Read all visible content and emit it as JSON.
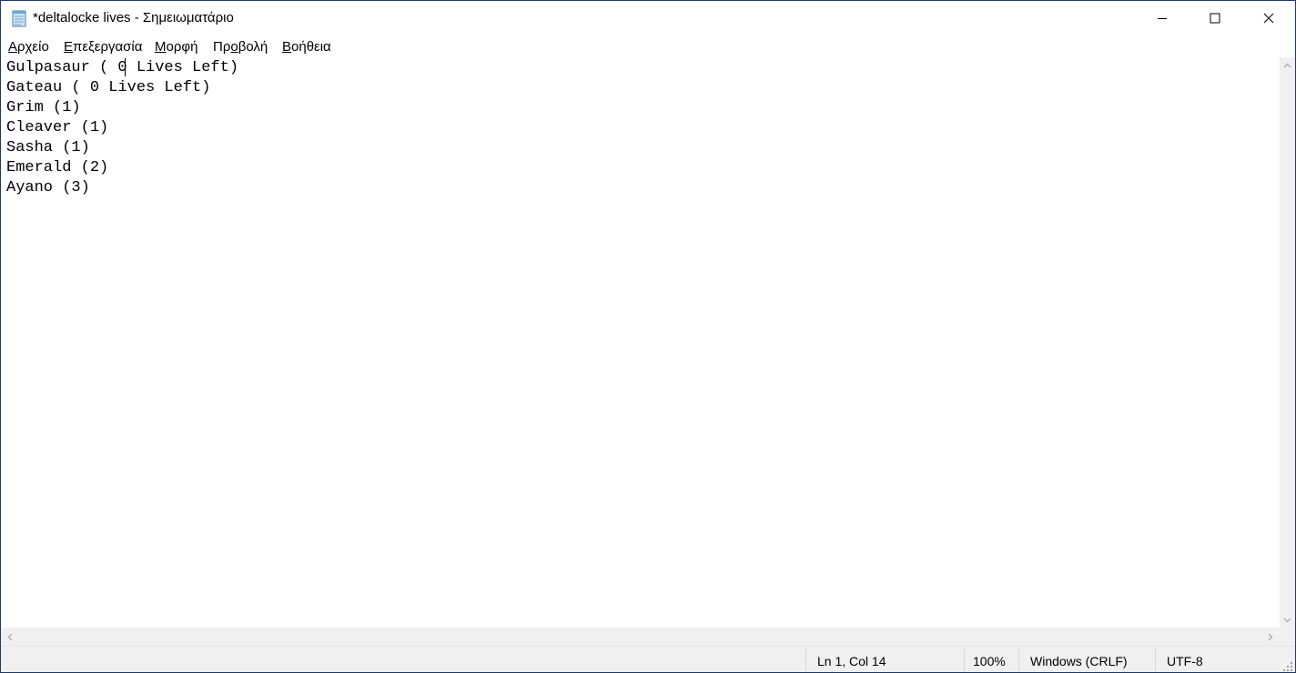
{
  "window": {
    "title": "*deltalocke lives - Σημειωματάριο"
  },
  "menu": {
    "items": [
      {
        "pre": "",
        "acc": "Α",
        "post": "ρχείο"
      },
      {
        "pre": "",
        "acc": "Ε",
        "post": "πεξεργασία"
      },
      {
        "pre": "",
        "acc": "Μ",
        "post": "ορφή"
      },
      {
        "pre": "Πρ",
        "acc": "ο",
        "post": "βολή"
      },
      {
        "pre": "",
        "acc": "Β",
        "post": "οήθεια"
      }
    ]
  },
  "editor": {
    "lines": [
      "Gulpasaur ( 0 Lives Left)",
      "Gateau ( 0 Lives Left)",
      "Grim (1)",
      "Cleaver (1)",
      "Sasha (1)",
      "Emerald (2)",
      "Ayano (3)"
    ]
  },
  "status": {
    "position": "Ln 1, Col 14",
    "zoom": "100%",
    "line_ending": "Windows (CRLF)",
    "encoding": "UTF-8"
  },
  "icons": {
    "app": "notepad-icon",
    "minimize": "minimize-icon",
    "maximize": "maximize-icon",
    "close": "close-icon"
  }
}
